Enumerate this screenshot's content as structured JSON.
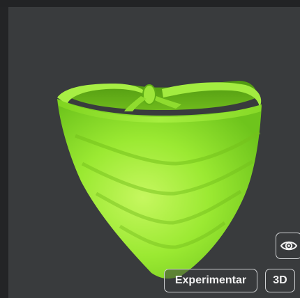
{
  "viewer": {
    "item_image_name": "lime-green-bandana",
    "try_on_label": "Experimentar",
    "view_3d_label": "3D",
    "toggle_icon": "eye-icon"
  },
  "colors": {
    "viewport_bg": "#393b3d",
    "item_main": "#8fe72a",
    "item_highlight": "#bff55a",
    "item_shadow": "#5eae16",
    "button_border": "#cfd1d3",
    "button_text": "#f2f2f2"
  }
}
